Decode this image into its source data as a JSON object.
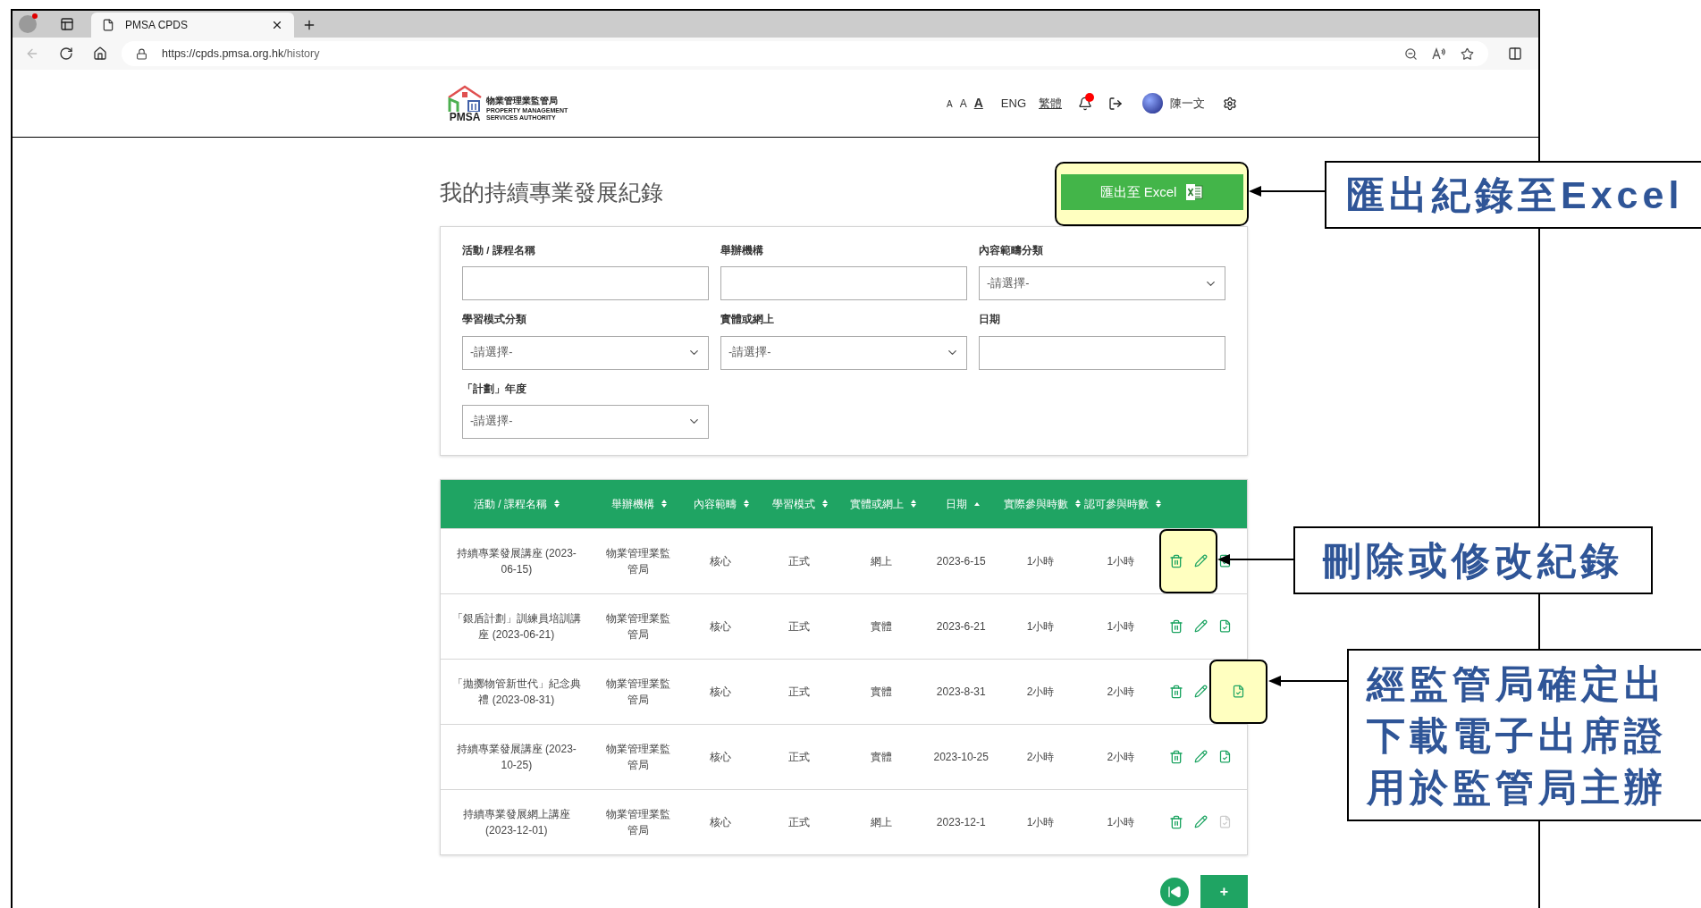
{
  "browser": {
    "tab_title": "PMSA CPDS",
    "url_host": "https://cpds.pmsa.org.hk",
    "url_path": "/history",
    "profile_alert": true
  },
  "header": {
    "logo_abbr": "PMSA",
    "logo_chinese": "物業管理業監管局",
    "logo_english": [
      "PROPERTY MANAGEMENT",
      "SERVICES AUTHORITY"
    ],
    "font_sizes": [
      {
        "label": "A",
        "selected": false
      },
      {
        "label": "A",
        "selected": false
      },
      {
        "label": "A",
        "selected": true
      }
    ],
    "languages": [
      {
        "label": "ENG",
        "selected": false
      },
      {
        "label": "繁體",
        "selected": true
      }
    ],
    "notification": true,
    "user_name": "陳一文"
  },
  "page_title": "我的持續專業發展紀錄",
  "export_button": "匯出至 Excel",
  "export_highlighted": true,
  "filters": [
    {
      "kind": "text",
      "label": "活動 / 課程名稱"
    },
    {
      "kind": "text",
      "label": "舉辦機構"
    },
    {
      "kind": "select",
      "label": "內容範疇分類",
      "value": "-請選擇-"
    },
    {
      "kind": "select",
      "label": "學習模式分類",
      "value": "-請選擇-"
    },
    {
      "kind": "select",
      "label": "實體或網上",
      "value": "-請選擇-"
    },
    {
      "kind": "text",
      "label": "日期"
    },
    {
      "kind": "select",
      "label": "「計劃」年度",
      "value": "-請選擇-"
    }
  ],
  "table": {
    "columns": [
      {
        "label": "活動 / 課程名稱",
        "sorted": false
      },
      {
        "label": "舉辦機構",
        "sorted": false
      },
      {
        "label": "內容範疇",
        "sorted": false
      },
      {
        "label": "學習模式",
        "sorted": false
      },
      {
        "label": "實體或網上",
        "sorted": false
      },
      {
        "label": "日期",
        "sorted": true
      },
      {
        "label": "實際參與時數",
        "sorted": false
      },
      {
        "label": "認可參與時數",
        "sorted": false
      }
    ],
    "rows": [
      {
        "cells": [
          "持續專業發展講座 (2023-06-15)",
          "物業管理業監管局",
          "核心",
          "正式",
          "網上",
          "2023-6-15",
          "1小時",
          "1小時"
        ],
        "certificate_available": true,
        "actions_highlighted": true,
        "certificate_highlighted": false
      },
      {
        "cells": [
          "「銀盾計劃」訓練員培訓講座 (2023-06-21)",
          "物業管理業監管局",
          "核心",
          "正式",
          "實體",
          "2023-6-21",
          "1小時",
          "1小時"
        ],
        "certificate_available": true,
        "actions_highlighted": false,
        "certificate_highlighted": false
      },
      {
        "cells": [
          "「拋擲物管新世代」紀念典禮 (2023-08-31)",
          "物業管理業監管局",
          "核心",
          "正式",
          "實體",
          "2023-8-31",
          "2小時",
          "2小時"
        ],
        "certificate_available": true,
        "actions_highlighted": false,
        "certificate_highlighted": true
      },
      {
        "cells": [
          "持續專業發展講座 (2023-10-25)",
          "物業管理業監管局",
          "核心",
          "正式",
          "實體",
          "2023-10-25",
          "2小時",
          "2小時"
        ],
        "certificate_available": true,
        "actions_highlighted": false,
        "certificate_highlighted": false
      },
      {
        "cells": [
          "持續專業發展網上講座 (2023-12-01)",
          "物業管理業監管局",
          "核心",
          "正式",
          "網上",
          "2023-12-1",
          "1小時",
          "1小時"
        ],
        "certificate_available": false,
        "actions_highlighted": false,
        "certificate_highlighted": false
      }
    ]
  },
  "pagination": {
    "add_button": "+"
  },
  "annotations": [
    {
      "lines": [
        "匯出紀錄至Excel"
      ]
    },
    {
      "lines": [
        "刪除或修改紀錄"
      ]
    },
    {
      "lines": [
        "經監管局確定出",
        "下載電子出席證",
        "用於監管局主辦"
      ]
    }
  ]
}
